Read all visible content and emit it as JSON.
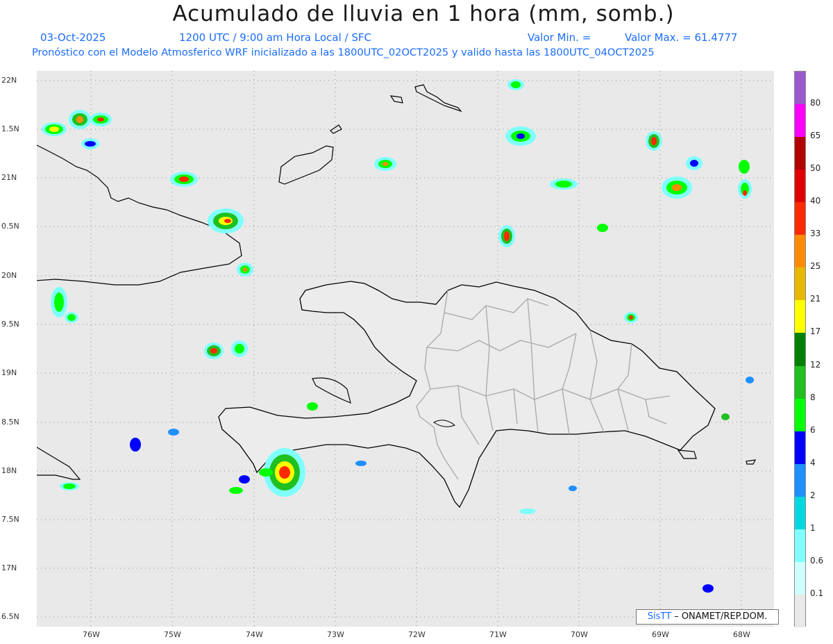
{
  "header": {
    "title": "Acumulado de lluvia en 1 hora (mm, somb.)",
    "date": "03-Oct-2025",
    "time_label": "1200 UTC / 9:00 am Hora Local / SFC",
    "valor_min": "Valor Min. =",
    "valor_max": "Valor Max. = 61.4777",
    "forecast_line": "Pronóstico con el Modelo Atmosferico WRF inicializado a las 1800UTC_02OCT2025 y valido hasta las  1800UTC_04OCT2025"
  },
  "axes": {
    "y_labels": [
      "22N",
      "1.5N",
      "21N",
      "0.5N",
      "20N",
      "9.5N",
      "19N",
      "8.5N",
      "18N",
      "7.5N",
      "17N",
      "6.5N"
    ],
    "x_labels": [
      "76W",
      "75W",
      "74W",
      "73W",
      "72W",
      "71W",
      "70W",
      "69W",
      "68W"
    ]
  },
  "legend": {
    "labels": [
      "80",
      "65",
      "50",
      "40",
      "33",
      "25",
      "21",
      "17",
      "12",
      "8",
      "6",
      "4",
      "2",
      "1",
      "0.6",
      "0.1"
    ],
    "colors": [
      "#9b59d0",
      "#ff00ff",
      "#b30000",
      "#e00000",
      "#ff2a00",
      "#ff8c00",
      "#e6b800",
      "#ffff00",
      "#008000",
      "#20c020",
      "#00ff00",
      "#0000ff",
      "#1e90ff",
      "#00d8e0",
      "#80ffff",
      "#d0ffff",
      "#e9e9e9"
    ]
  },
  "credit": {
    "sis": "SisTT",
    "org": " – ONAMET/REP.DOM."
  },
  "colors": {
    "header_blue": "#1a6cff",
    "map_bg": "#e9e9e9",
    "coast": "#000000",
    "province_border": "#a8a8a8"
  }
}
